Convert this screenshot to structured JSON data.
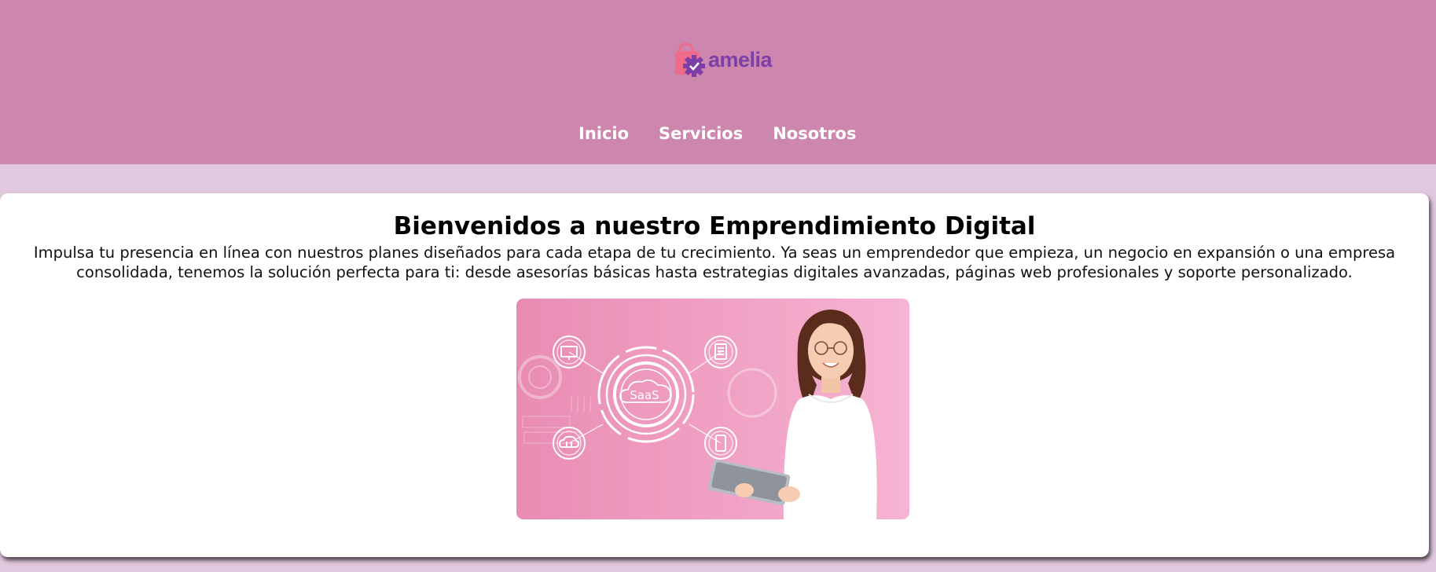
{
  "header": {
    "logo_text": "amelia",
    "nav": [
      {
        "label": "Inicio"
      },
      {
        "label": "Servicios"
      },
      {
        "label": "Nosotros"
      }
    ]
  },
  "main": {
    "title": "Bienvenidos a nuestro Emprendimiento Digital",
    "description": "Impulsa tu presencia en línea con nuestros planes diseñados para cada etapa de tu crecimiento. Ya seas un emprendedor que empieza, un negocio en expansión o una empresa consolidada, tenemos la solución perfecta para ti: desde asesorías básicas hasta estrategias digitales avanzadas, páginas web profesionales y soporte personalizado.",
    "hero_image": {
      "center_label": "SaaS",
      "icons": [
        "monitor-icon",
        "document-icon",
        "cloud-icon",
        "smartphone-icon"
      ]
    }
  },
  "colors": {
    "header_bg": "#cd86ad",
    "page_bg": "#e2c8de",
    "logo_purple": "#7c3fa6",
    "logo_pink": "#f06b8a",
    "hero_bg": "#ee9cc0"
  }
}
